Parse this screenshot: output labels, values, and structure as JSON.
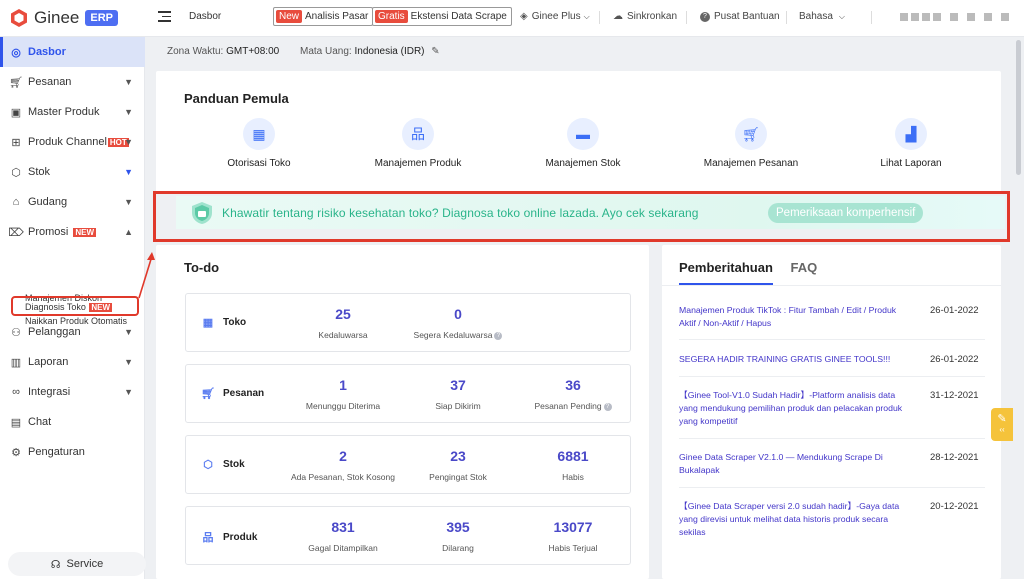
{
  "app": {
    "name": "Ginee",
    "badge": "ERP"
  },
  "topbar": {
    "breadcrumb": "Dasbor",
    "analysis_tag": "New",
    "analysis_label": "Analisis Pasar",
    "scrape_tag": "Gratis",
    "scrape_label": "Ekstensi Data Scrape",
    "plus_label": "Ginee Plus",
    "sync_label": "Sinkronkan",
    "help_label": "Pusat Bantuan",
    "language_label": "Bahasa"
  },
  "sidebar": {
    "items": [
      {
        "label": "Dasbor",
        "icon": "dashboard-icon"
      },
      {
        "label": "Pesanan",
        "icon": "cart-icon"
      },
      {
        "label": "Master Produk",
        "icon": "bag-icon"
      },
      {
        "label": "Produk Channel",
        "icon": "channel-icon",
        "badge": "HOT"
      },
      {
        "label": "Stok",
        "icon": "box-icon"
      },
      {
        "label": "Gudang",
        "icon": "warehouse-icon"
      },
      {
        "label": "Promosi",
        "icon": "tag-icon",
        "badge": "NEW"
      },
      {
        "label": "Pelanggan",
        "icon": "users-icon"
      },
      {
        "label": "Laporan",
        "icon": "chart-icon"
      },
      {
        "label": "Integrasi",
        "icon": "link-icon"
      },
      {
        "label": "Chat",
        "icon": "chat-icon"
      },
      {
        "label": "Pengaturan",
        "icon": "gear-icon"
      }
    ],
    "sub_items": [
      {
        "label": "Manajemen Diskon"
      },
      {
        "label": "Naikkan Produk Otomatis"
      },
      {
        "label": "Diagnosis Toko",
        "badge": "NEW"
      }
    ],
    "service_label": "Service"
  },
  "info": {
    "timezone_label": "Zona Waktu:",
    "timezone_value": "GMT+08:00",
    "currency_label": "Mata Uang:",
    "currency_value": "Indonesia (IDR)"
  },
  "guide": {
    "title": "Panduan Pemula",
    "items": [
      {
        "label": "Otorisasi Toko",
        "icon": "store-icon"
      },
      {
        "label": "Manajemen Produk",
        "icon": "hierarchy-icon"
      },
      {
        "label": "Manajemen Stok",
        "icon": "box-icon"
      },
      {
        "label": "Manajemen Pesanan",
        "icon": "cart-icon"
      },
      {
        "label": "Lihat Laporan",
        "icon": "bar-chart-icon"
      }
    ]
  },
  "banner": {
    "text": "Khawatir tentang risiko kesehatan toko? Diagnosa toko online lazada. Ayo cek sekarang",
    "button": "Pemeriksaan komperhensif"
  },
  "todo": {
    "title": "To-do",
    "groups": [
      {
        "label": "Toko",
        "icon": "store-icon",
        "metrics": [
          {
            "value": "25",
            "caption": "Kedaluwarsa",
            "help": false
          },
          {
            "value": "0",
            "caption": "Segera Kedaluwarsa",
            "help": true
          }
        ]
      },
      {
        "label": "Pesanan",
        "icon": "cart-icon",
        "metrics": [
          {
            "value": "1",
            "caption": "Menunggu Diterima",
            "help": false
          },
          {
            "value": "37",
            "caption": "Siap Dikirim",
            "help": false
          },
          {
            "value": "36",
            "caption": "Pesanan Pending",
            "help": true
          }
        ]
      },
      {
        "label": "Stok",
        "icon": "box-icon",
        "metrics": [
          {
            "value": "2",
            "caption": "Ada Pesanan, Stok Kosong",
            "help": false
          },
          {
            "value": "23",
            "caption": "Pengingat Stok",
            "help": false
          },
          {
            "value": "6881",
            "caption": "Habis",
            "help": false
          }
        ]
      },
      {
        "label": "Produk",
        "icon": "hierarchy-icon",
        "metrics": [
          {
            "value": "831",
            "caption": "Gagal Ditampilkan",
            "help": false
          },
          {
            "value": "395",
            "caption": "Dilarang",
            "help": false
          },
          {
            "value": "13077",
            "caption": "Habis Terjual",
            "help": false
          }
        ]
      }
    ]
  },
  "notifications": {
    "tab_active": "Pemberitahuan",
    "tab_other": "FAQ",
    "items": [
      {
        "text": "Manajemen Produk TikTok : Fitur Tambah / Edit / Produk Aktif / Non-Aktif / Hapus",
        "date": "26-01-2022"
      },
      {
        "text": "SEGERA HADIR TRAINING GRATIS GINEE TOOLS!!!",
        "date": "26-01-2022"
      },
      {
        "text": "【Ginee Tool-V1.0 Sudah Hadir】-Platform analisis data yang mendukung pemilihan produk dan pelacakan produk yang kompetitif",
        "date": "31-12-2021"
      },
      {
        "text": "Ginee Data Scraper V2.1.0 — Mendukung Scrape Di Bukalapak",
        "date": "28-12-2021"
      },
      {
        "text": "【Ginee Data Scraper versi 2.0 sudah hadir】-Gaya data yang direvisi untuk melihat data historis produk secara sekilas",
        "date": "20-12-2021"
      }
    ]
  },
  "colors": {
    "accent": "#2f54eb",
    "metric": "#4a49c8",
    "banner_text": "#2ab48a",
    "highlight": "#e0392b"
  }
}
